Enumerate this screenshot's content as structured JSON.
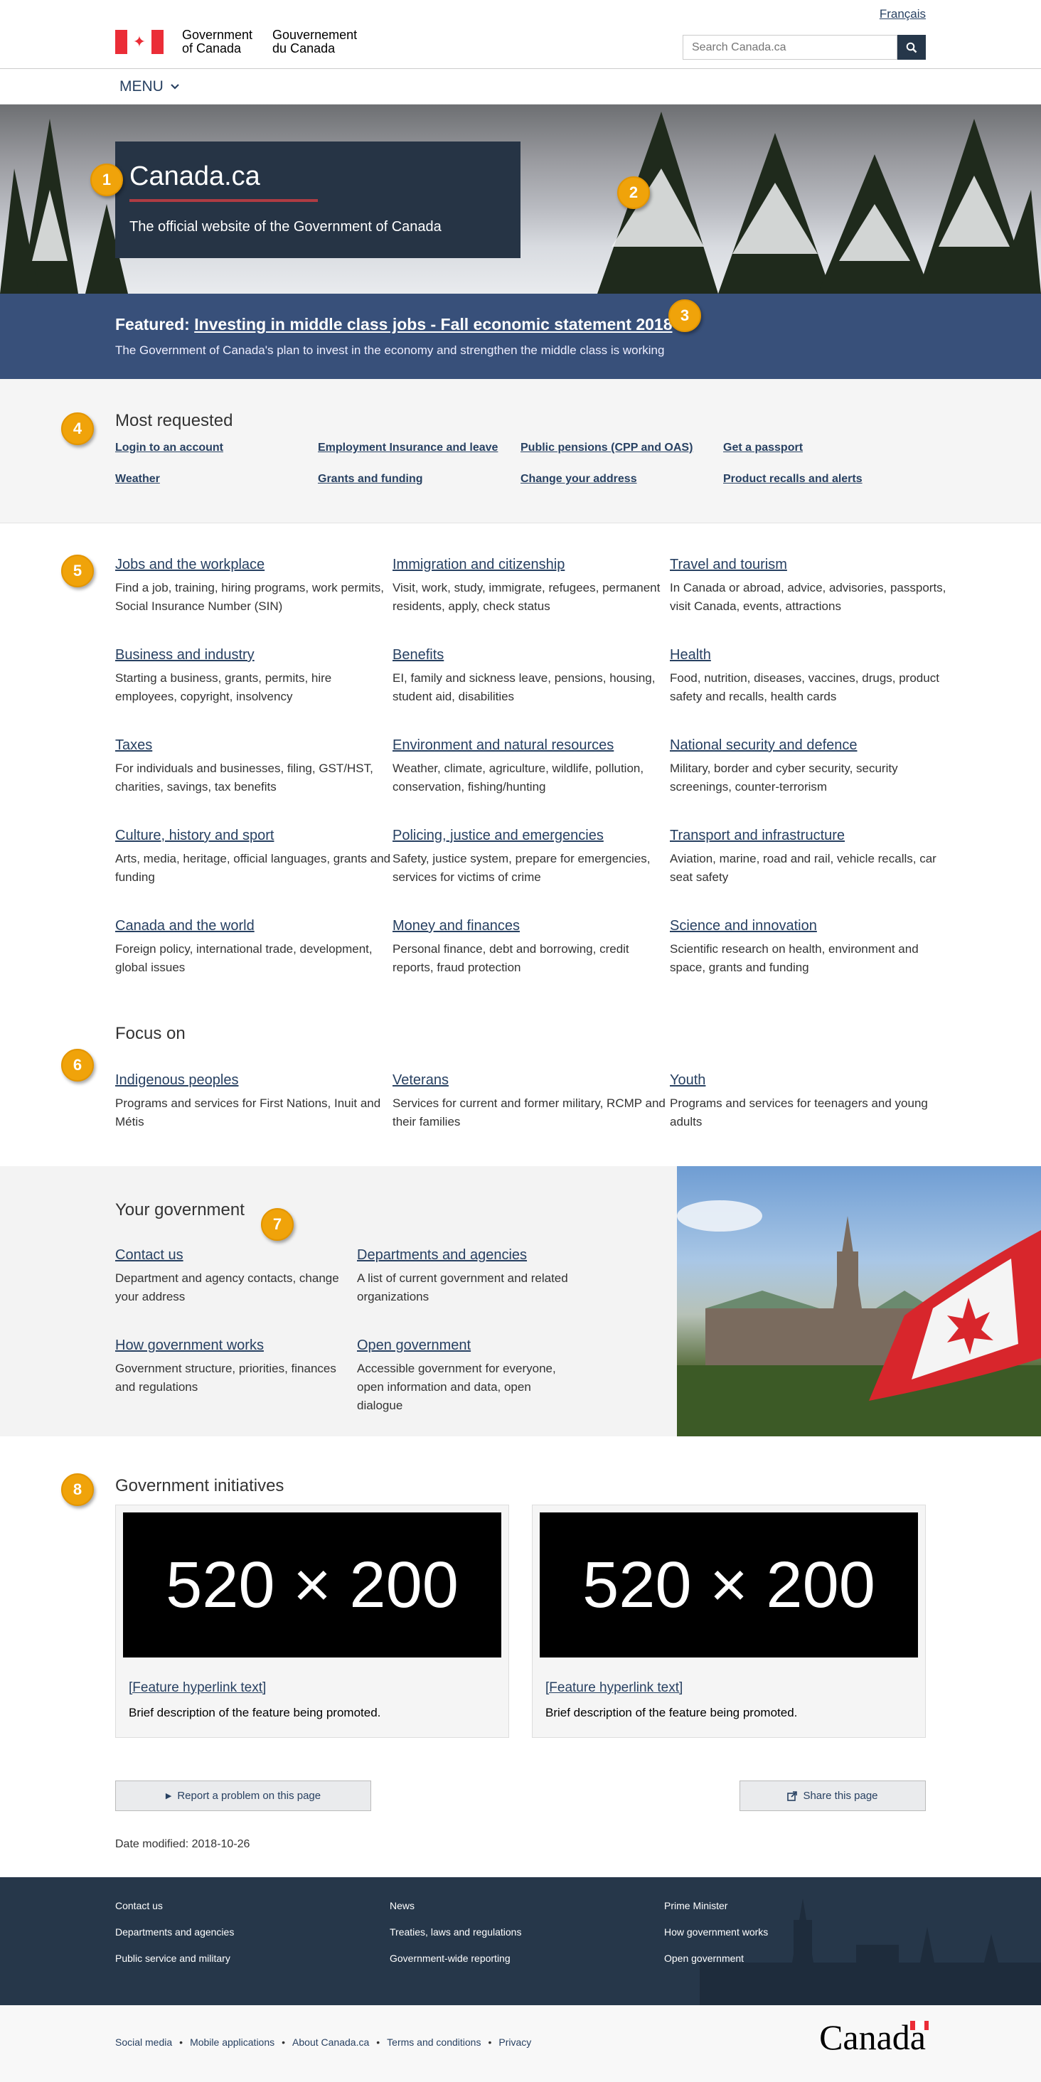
{
  "header": {
    "language_toggle": "Français",
    "signature_en": "Government\nof Canada",
    "signature_fr": "Gouvernement\ndu Canada",
    "search_placeholder": "Search Canada.ca",
    "menu_label": "MENU"
  },
  "hero": {
    "title": "Canada.ca",
    "subtitle": "The official website of the Government of Canada"
  },
  "featured": {
    "prefix": "Featured:",
    "link": "Investing in middle class jobs - Fall economic statement 2018",
    "description": "The Government of Canada's plan to invest in the economy and strengthen the middle class is working"
  },
  "most_requested": {
    "title": "Most requested",
    "links": [
      "Login to an account",
      "Employment Insurance and leave",
      "Public pensions (CPP and OAS)",
      "Get a passport",
      "Weather",
      "Grants and funding",
      "Change your address",
      "Product recalls and alerts"
    ]
  },
  "topics": [
    {
      "title": "Jobs and the workplace",
      "desc": "Find a job, training, hiring programs, work permits, Social Insurance Number (SIN)"
    },
    {
      "title": "Immigration and citizenship",
      "desc": "Visit, work, study, immigrate, refugees, permanent residents, apply, check status"
    },
    {
      "title": "Travel and tourism",
      "desc": "In Canada or abroad, advice, advisories, passports, visit Canada, events, attractions"
    },
    {
      "title": "Business and industry",
      "desc": "Starting a business, grants, permits, hire employees, copyright, insolvency"
    },
    {
      "title": "Benefits",
      "desc": "EI, family and sickness leave, pensions, housing, student aid, disabilities"
    },
    {
      "title": "Health",
      "desc": "Food, nutrition, diseases, vaccines, drugs, product safety and recalls, health cards"
    },
    {
      "title": "Taxes",
      "desc": "For individuals and businesses, filing, GST/HST, charities, savings, tax benefits"
    },
    {
      "title": "Environment and natural resources",
      "desc": "Weather, climate, agriculture, wildlife, pollution, conservation, fishing/hunting"
    },
    {
      "title": "National security and defence",
      "desc": "Military, border and cyber security, security screenings, counter-terrorism"
    },
    {
      "title": "Culture, history and sport",
      "desc": "Arts, media, heritage, official languages, grants and funding"
    },
    {
      "title": "Policing, justice and emergencies",
      "desc": "Safety, justice system, prepare for emergencies, services for victims of crime"
    },
    {
      "title": "Transport and infrastructure",
      "desc": "Aviation, marine, road and rail, vehicle recalls, car seat safety"
    },
    {
      "title": "Canada and the world",
      "desc": "Foreign policy, international trade, development, global issues"
    },
    {
      "title": "Money and finances",
      "desc": "Personal finance, debt and borrowing, credit reports, fraud protection"
    },
    {
      "title": "Science and innovation",
      "desc": "Scientific research on health, environment and space, grants and funding"
    }
  ],
  "focus": {
    "title": "Focus on",
    "items": [
      {
        "title": "Indigenous peoples",
        "desc": "Programs and services for First Nations, Inuit and Métis"
      },
      {
        "title": "Veterans",
        "desc": "Services for current and former military, RCMP and their families"
      },
      {
        "title": "Youth",
        "desc": "Programs and services for teenagers and young adults"
      }
    ]
  },
  "your_government": {
    "title": "Your government",
    "items": [
      {
        "title": "Contact us",
        "desc": "Department and agency contacts, change your address"
      },
      {
        "title": "Departments and agencies",
        "desc": "A list of current government and related organizations"
      },
      {
        "title": "How government works",
        "desc": "Government structure, priorities, finances and regulations"
      },
      {
        "title": "Open government",
        "desc": "Accessible government for everyone, open information and data, open dialogue"
      }
    ]
  },
  "initiatives": {
    "title": "Government initiatives",
    "cards": [
      {
        "placeholder": "520 × 200",
        "link": "[Feature hyperlink text]",
        "desc": "Brief description of the feature being promoted."
      },
      {
        "placeholder": "520 × 200",
        "link": "[Feature hyperlink text]",
        "desc": "Brief description of the feature being promoted."
      }
    ]
  },
  "actions": {
    "report": "Report a problem on this page",
    "share": "Share this page"
  },
  "date_modified": "Date modified: 2018-10-26",
  "footer": {
    "col1": [
      "Contact us",
      "Departments and agencies",
      "Public service and military"
    ],
    "col2": [
      "News",
      "Treaties, laws and regulations",
      "Government-wide reporting"
    ],
    "col3": [
      "Prime Minister",
      "How government works",
      "Open government"
    ],
    "sub_links": [
      "Social media",
      "Mobile applications",
      "About Canada.ca",
      "Terms and conditions",
      "Privacy"
    ],
    "wordmark": "Canada"
  },
  "callouts": [
    "1",
    "2",
    "3",
    "4",
    "5",
    "6",
    "7",
    "8"
  ],
  "colors": {
    "primary": "#26374a",
    "link": "#284162",
    "accent_red": "#af3c43",
    "featured_bg": "#38507a",
    "callout": "#f0a30a"
  }
}
